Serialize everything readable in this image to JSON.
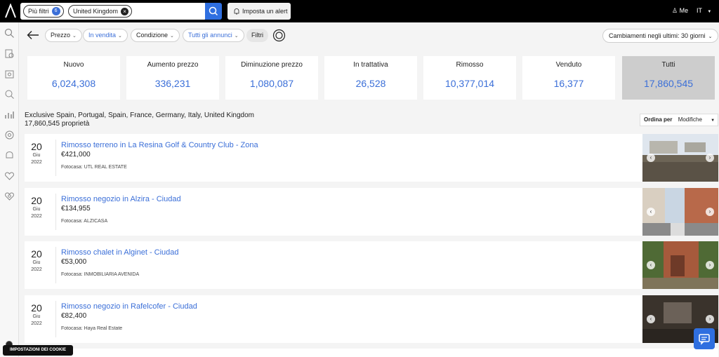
{
  "topbar": {
    "filter_chip_label": "Più filtri",
    "filter_chip_count": "6",
    "location_chip_label": "United Kingdom",
    "alert_button_label": "Imposta un alert",
    "user_label": "Me",
    "language_label": "IT"
  },
  "filters": {
    "price": "Prezzo",
    "status": "In vendita",
    "condition": "Condizione",
    "listings": "Tutti gli annunci",
    "filters_button": "Filtri",
    "changes_dropdown": "Cambiamenti negli ultimi: 30 giorni"
  },
  "stats": [
    {
      "label": "Nuovo",
      "value": "6,024,308"
    },
    {
      "label": "Aumento prezzo",
      "value": "336,231"
    },
    {
      "label": "Diminuzione prezzo",
      "value": "1,080,087"
    },
    {
      "label": "In trattativa",
      "value": "26,528"
    },
    {
      "label": "Rimosso",
      "value": "10,377,014"
    },
    {
      "label": "Venduto",
      "value": "16,377"
    },
    {
      "label": "Tutti",
      "value": "17,860,545"
    }
  ],
  "summary": {
    "regions": "Exclusive Spain, Portugal, Spain, France, Germany, Italy, United Kingdom",
    "count": "17,860,545 proprietà"
  },
  "sort": {
    "label": "Ordina per",
    "value": "Modifiche"
  },
  "listings": [
    {
      "day": "20",
      "month": "Giu",
      "year": "2022",
      "title": "Rimosso terreno in La Resina Golf & Country Club - Zona",
      "price": "€421,000",
      "agency": "Fotocasa: UTL REAL ESTATE"
    },
    {
      "day": "20",
      "month": "Giu",
      "year": "2022",
      "title": "Rimosso negozio in Alzira - Ciudad",
      "price": "€134,955",
      "agency": "Fotocasa: ALZICASA"
    },
    {
      "day": "20",
      "month": "Giu",
      "year": "2022",
      "title": "Rimosso chalet in Alginet - Ciudad",
      "price": "€53,000",
      "agency": "Fotocasa: INMOBILIARIA AVENIDA"
    },
    {
      "day": "20",
      "month": "Giu",
      "year": "2022",
      "title": "Rimosso negozio in Rafelcofer - Ciudad",
      "price": "€82,400",
      "agency": "Fotocasa: Haya Real Estate"
    }
  ],
  "cookie_button": "IMPOSTAZIONI DEI COOKIE",
  "colors": {
    "accent": "#3b6fd8",
    "topbar": "#000000",
    "active_card": "#cdcdcd"
  }
}
